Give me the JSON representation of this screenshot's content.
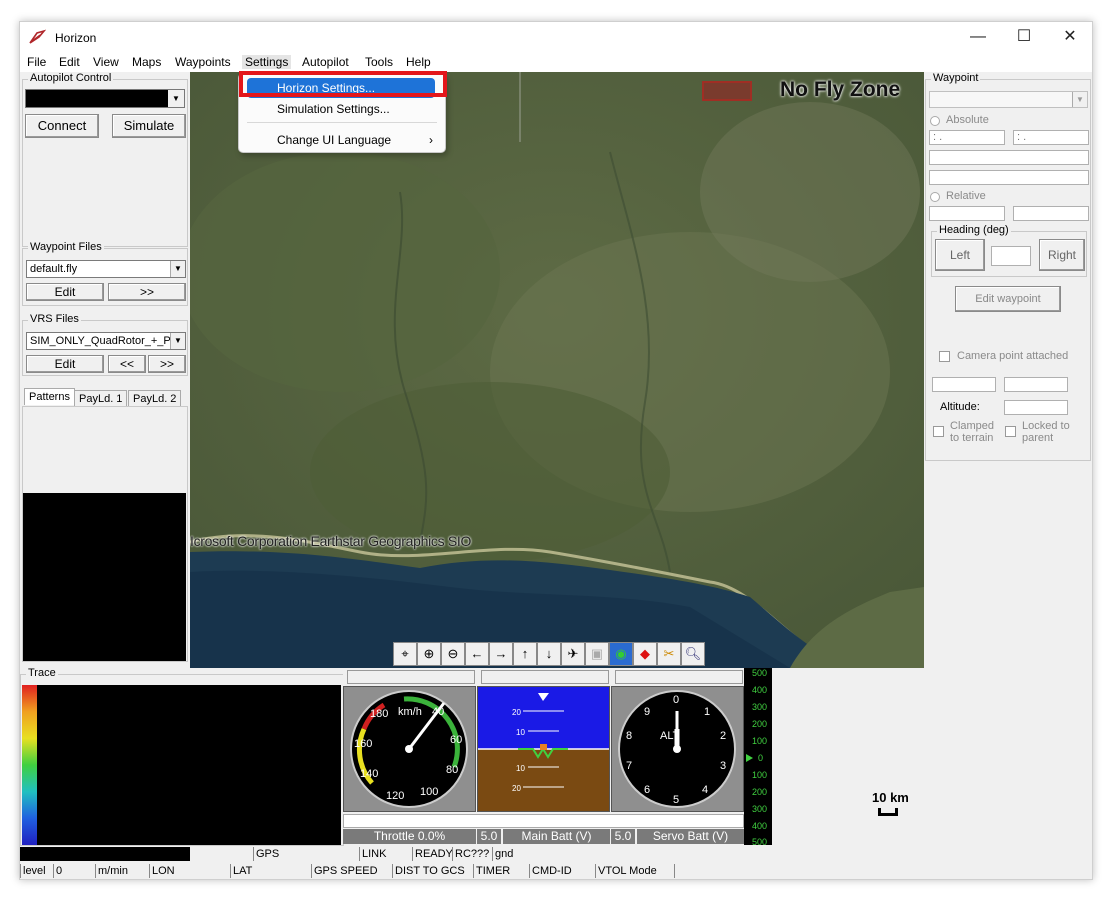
{
  "window": {
    "title": "Horizon",
    "min": "—",
    "max": "☐",
    "close": "✕"
  },
  "menubar": [
    "File",
    "Edit",
    "View",
    "Maps",
    "Waypoints",
    "Settings",
    "Autopilot",
    "Tools",
    "Help"
  ],
  "settings_menu": {
    "items": [
      "Horizon Settings...",
      "Simulation Settings...",
      "Change UI Language"
    ],
    "submenu_arrow": "›"
  },
  "autopilot_control": {
    "label": "Autopilot Control",
    "connect": "Connect",
    "simulate": "Simulate"
  },
  "waypoint_files": {
    "label": "Waypoint Files",
    "file": "default.fly",
    "edit": "Edit",
    "next": ">>"
  },
  "vrs_files": {
    "label": "VRS Files",
    "file": "SIM_ONLY_QuadRotor_+_P",
    "edit": "Edit",
    "prev": "<<",
    "next": ">>"
  },
  "tabs": [
    "Patterns",
    "PayLd. 1",
    "PayLd. 2"
  ],
  "map": {
    "no_fly_zone": "No Fly Zone",
    "attribution": "Icrosoft Corporation Earthstar Geographics  SIO",
    "scale": "10 km"
  },
  "map_tools": [
    "center-icon",
    "zoom-in-icon",
    "zoom-out-icon",
    "pan-left-icon",
    "pan-right-icon",
    "pan-up-icon",
    "pan-down-icon",
    "aircraft-icon",
    "camera-icon",
    "globe-icon",
    "waypoint-icon",
    "tools-icon",
    "search-icon"
  ],
  "waypoint_panel": {
    "label": "Waypoint",
    "absolute": "Absolute",
    "relative": "Relative",
    "colon1": ":   .",
    "colon2": ":   .",
    "heading_label": "Heading (deg)",
    "left": "Left",
    "right": "Right",
    "edit_waypoint": "Edit waypoint",
    "camera_point": "Camera point attached",
    "altitude": "Altitude:",
    "clamped": "Clamped to terrain",
    "locked": "Locked to parent"
  },
  "trace": {
    "label": "Trace"
  },
  "gauges": {
    "airspeed_unit": "km/h",
    "airspeed_ticks": [
      "40",
      "60",
      "80",
      "100",
      "120",
      "140",
      "160",
      "180"
    ],
    "altimeter_label": "ALT",
    "altimeter_ticks": [
      "0",
      "1",
      "2",
      "3",
      "4",
      "5",
      "6",
      "7",
      "8",
      "9"
    ],
    "throttle": "Throttle 0.0%",
    "main_batt_value": "5.0",
    "main_batt_label": "Main Batt (V)",
    "servo_batt_value": "5.0",
    "servo_batt_label": "Servo Batt (V)",
    "vsi_ticks": [
      "500",
      "400",
      "300",
      "200",
      "100",
      "0",
      "100",
      "200",
      "300",
      "400",
      "500"
    ],
    "horizon_ticks": [
      "20",
      "10",
      "10",
      "20"
    ]
  },
  "status_row1": [
    "GPS",
    "LINK",
    "READY",
    "RC???",
    "gnd"
  ],
  "status_row2": [
    "level",
    "0",
    "m/min",
    "LON",
    "LAT",
    "GPS SPEED",
    "DIST TO GCS",
    "TIMER",
    "CMD-ID",
    "VTOL Mode"
  ],
  "colors": {
    "highlight": "#1e73d8",
    "annotation": "#e3161b",
    "panel": "#f0f0f0"
  }
}
